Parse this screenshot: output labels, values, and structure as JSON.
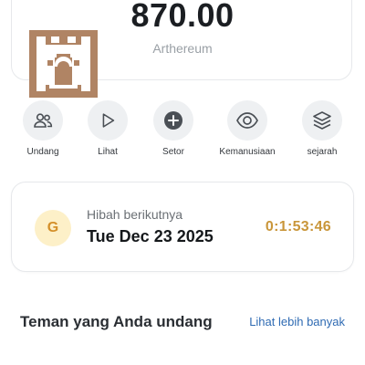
{
  "balance": {
    "amount": "870.00",
    "currency": "Arthereum",
    "logo_icon": "castle-gate-icon",
    "logo_color": "#b08464"
  },
  "actions": [
    {
      "label": "Undang",
      "icon": "users-icon"
    },
    {
      "label": "Lihat",
      "icon": "play-icon"
    },
    {
      "label": "Setor",
      "icon": "plus-circle-icon"
    },
    {
      "label": "Kemanusiaan",
      "icon": "eye-icon"
    },
    {
      "label": "sejarah",
      "icon": "layers-icon"
    }
  ],
  "grant": {
    "badge": "G",
    "title": "Hibah berikutnya",
    "date": "Tue Dec 23 2025",
    "countdown": "0:1:53:46",
    "badge_color": "#fdf0c8",
    "countdown_color": "#c9963a"
  },
  "friends": {
    "title": "Teman yang Anda undang",
    "more_link": "Lihat lebih banyak",
    "link_color": "#2f6bb3"
  }
}
